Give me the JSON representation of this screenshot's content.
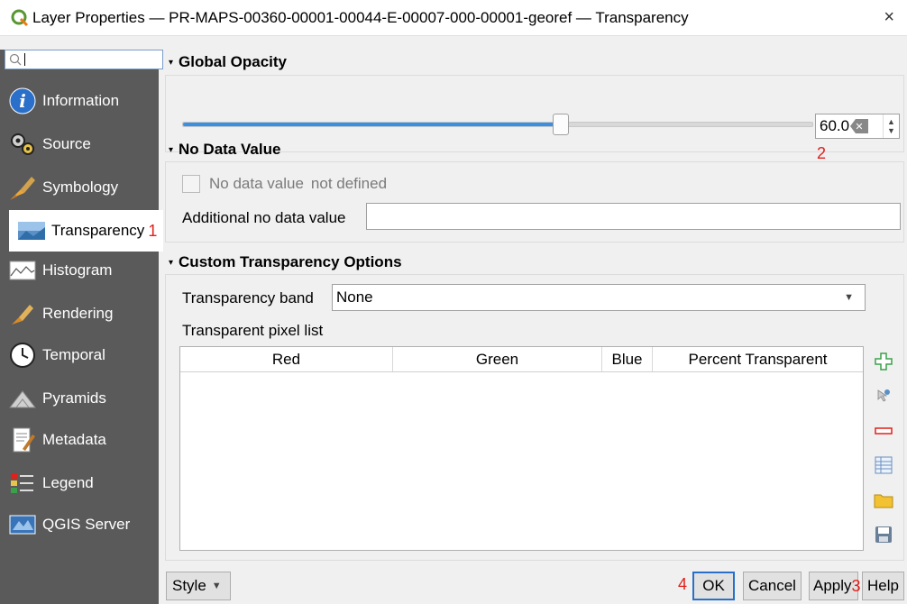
{
  "window": {
    "title": "Layer Properties — PR-MAPS-00360-00001-00044-E-00007-000-00001-georef — Transparency",
    "close_glyph": "×"
  },
  "sidebar": {
    "search_placeholder": "",
    "items": [
      {
        "label": "Information",
        "icon": "information-icon"
      },
      {
        "label": "Source",
        "icon": "source-icon"
      },
      {
        "label": "Symbology",
        "icon": "symbology-icon"
      },
      {
        "label": "Transparency",
        "icon": "transparency-icon",
        "active": true,
        "annotation": "1"
      },
      {
        "label": "Histogram",
        "icon": "histogram-icon"
      },
      {
        "label": "Rendering",
        "icon": "rendering-icon"
      },
      {
        "label": "Temporal",
        "icon": "temporal-icon"
      },
      {
        "label": "Pyramids",
        "icon": "pyramids-icon"
      },
      {
        "label": "Metadata",
        "icon": "metadata-icon"
      },
      {
        "label": "Legend",
        "icon": "legend-icon"
      },
      {
        "label": "QGIS Server",
        "icon": "qgis-server-icon"
      }
    ]
  },
  "global_opacity": {
    "header": "Global Opacity",
    "value": "60.0",
    "slider_fraction": 0.6,
    "annotation": "2"
  },
  "no_data": {
    "header": "No Data Value",
    "checkbox_label": "No data value",
    "checkbox_state": "not defined",
    "additional_label": "Additional no data value",
    "additional_value": ""
  },
  "custom_transparency": {
    "header": "Custom Transparency Options",
    "band_label": "Transparency band",
    "band_value": "None",
    "pixel_list_label": "Transparent pixel list",
    "columns": [
      "Red",
      "Green",
      "Blue",
      "Percent Transparent"
    ],
    "rows": []
  },
  "buttons": {
    "style": "Style",
    "ok": "OK",
    "cancel": "Cancel",
    "apply": "Apply",
    "help": "Help",
    "ok_annotation": "4",
    "apply_annotation": "3"
  },
  "colors": {
    "sidebar_bg": "#5a5a5a",
    "slider_fill": "#3a8fe0",
    "annotation_red": "#e0201a"
  }
}
